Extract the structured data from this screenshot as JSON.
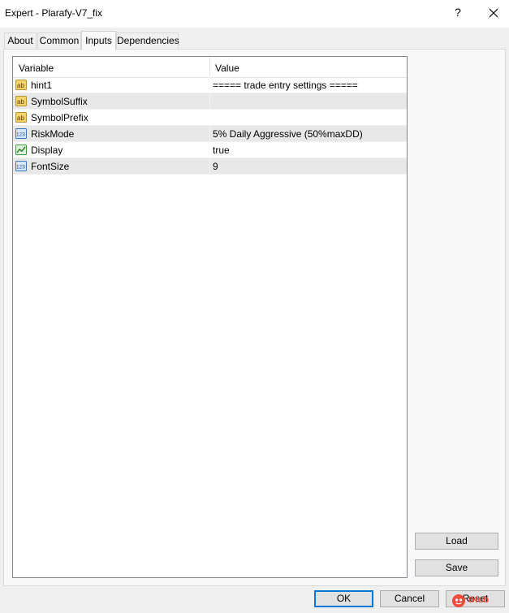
{
  "window": {
    "title": "Expert - Plarafy-V7_fix",
    "help_label": "?"
  },
  "tabs": [
    {
      "label": "About"
    },
    {
      "label": "Common"
    },
    {
      "label": "Inputs"
    },
    {
      "label": "Dependencies"
    }
  ],
  "active_tab": "Inputs",
  "inputs_grid": {
    "columns": {
      "variable": "Variable",
      "value": "Value"
    },
    "rows": [
      {
        "icon": "text-ab-icon",
        "name": "hint1",
        "value": "===== trade entry settings ====="
      },
      {
        "icon": "text-ab-icon",
        "name": "SymbolSuffix",
        "value": ""
      },
      {
        "icon": "text-ab-icon",
        "name": "SymbolPrefix",
        "value": ""
      },
      {
        "icon": "numeric-123-icon",
        "name": "RiskMode",
        "value": "5% Daily Aggressive (50%maxDD)"
      },
      {
        "icon": "boolean-chart-icon",
        "name": "Display",
        "value": "true"
      },
      {
        "icon": "numeric-123-icon",
        "name": "FontSize",
        "value": "9"
      }
    ]
  },
  "side_buttons": {
    "load": "Load",
    "save": "Save"
  },
  "footer_buttons": {
    "ok": "OK",
    "cancel": "Cancel",
    "reset": "Reset"
  },
  "watermark": {
    "text": "tHub"
  }
}
